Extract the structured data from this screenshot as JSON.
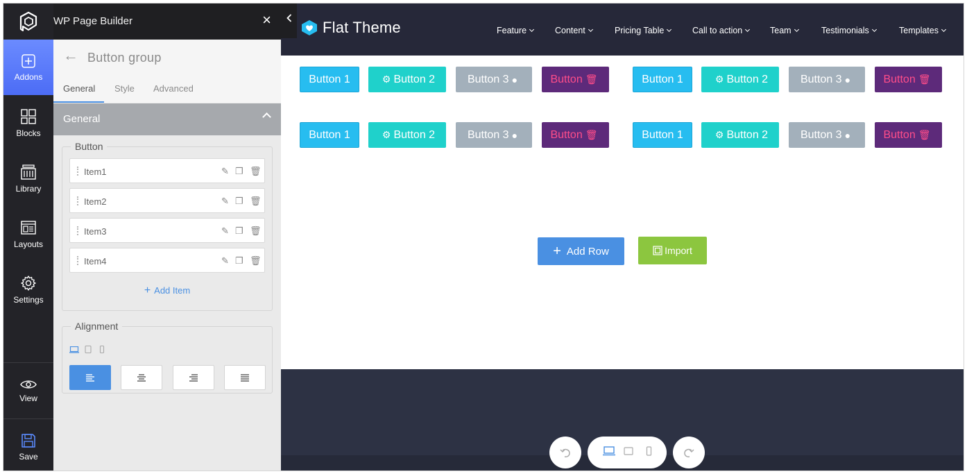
{
  "app": {
    "title": "WP Page Builder",
    "close_glyph": "×"
  },
  "rail": {
    "items": [
      {
        "label": "Addons",
        "icon": "plus-square-icon",
        "active": true
      },
      {
        "label": "Blocks",
        "icon": "blocks-icon"
      },
      {
        "label": "Library",
        "icon": "library-icon"
      },
      {
        "label": "Layouts",
        "icon": "layouts-icon"
      },
      {
        "label": "Settings",
        "icon": "gear-icon"
      },
      {
        "label": "View",
        "icon": "eye-icon"
      },
      {
        "label": "Save",
        "icon": "floppy-icon"
      }
    ]
  },
  "panel": {
    "addon_title": "Button group",
    "tabs": [
      "General",
      "Style",
      "Advanced"
    ],
    "active_tab": "General",
    "group_title": "General",
    "button_section": {
      "legend": "Button",
      "items": [
        "Item1",
        "Item2",
        "Item3",
        "Item4"
      ],
      "add_item_label": "Add Item"
    },
    "alignment_section": {
      "legend": "Alignment",
      "options": [
        "left",
        "center",
        "right",
        "justify"
      ],
      "selected": "left"
    }
  },
  "site": {
    "logo_text": "Flat Theme",
    "nav": [
      "Feature",
      "Content",
      "Pricing Table",
      "Call to action",
      "Team",
      "Testimonials",
      "Templates"
    ],
    "buttons": [
      "Button 1",
      "Button 2",
      "Button 3",
      "Button"
    ],
    "add_row_label": "Add Row",
    "import_label": "Import"
  },
  "colors": {
    "accent": "#4a90e2",
    "rail_active": "#5b7cfa",
    "nav_bg": "#262839",
    "btn1": "#27bdf0",
    "btn2": "#1fd1cb",
    "btn3": "#a3b0bb",
    "btn4_bg": "#5d2a7a",
    "btn4_text": "#ff4d8a",
    "import": "#8cc63f"
  }
}
